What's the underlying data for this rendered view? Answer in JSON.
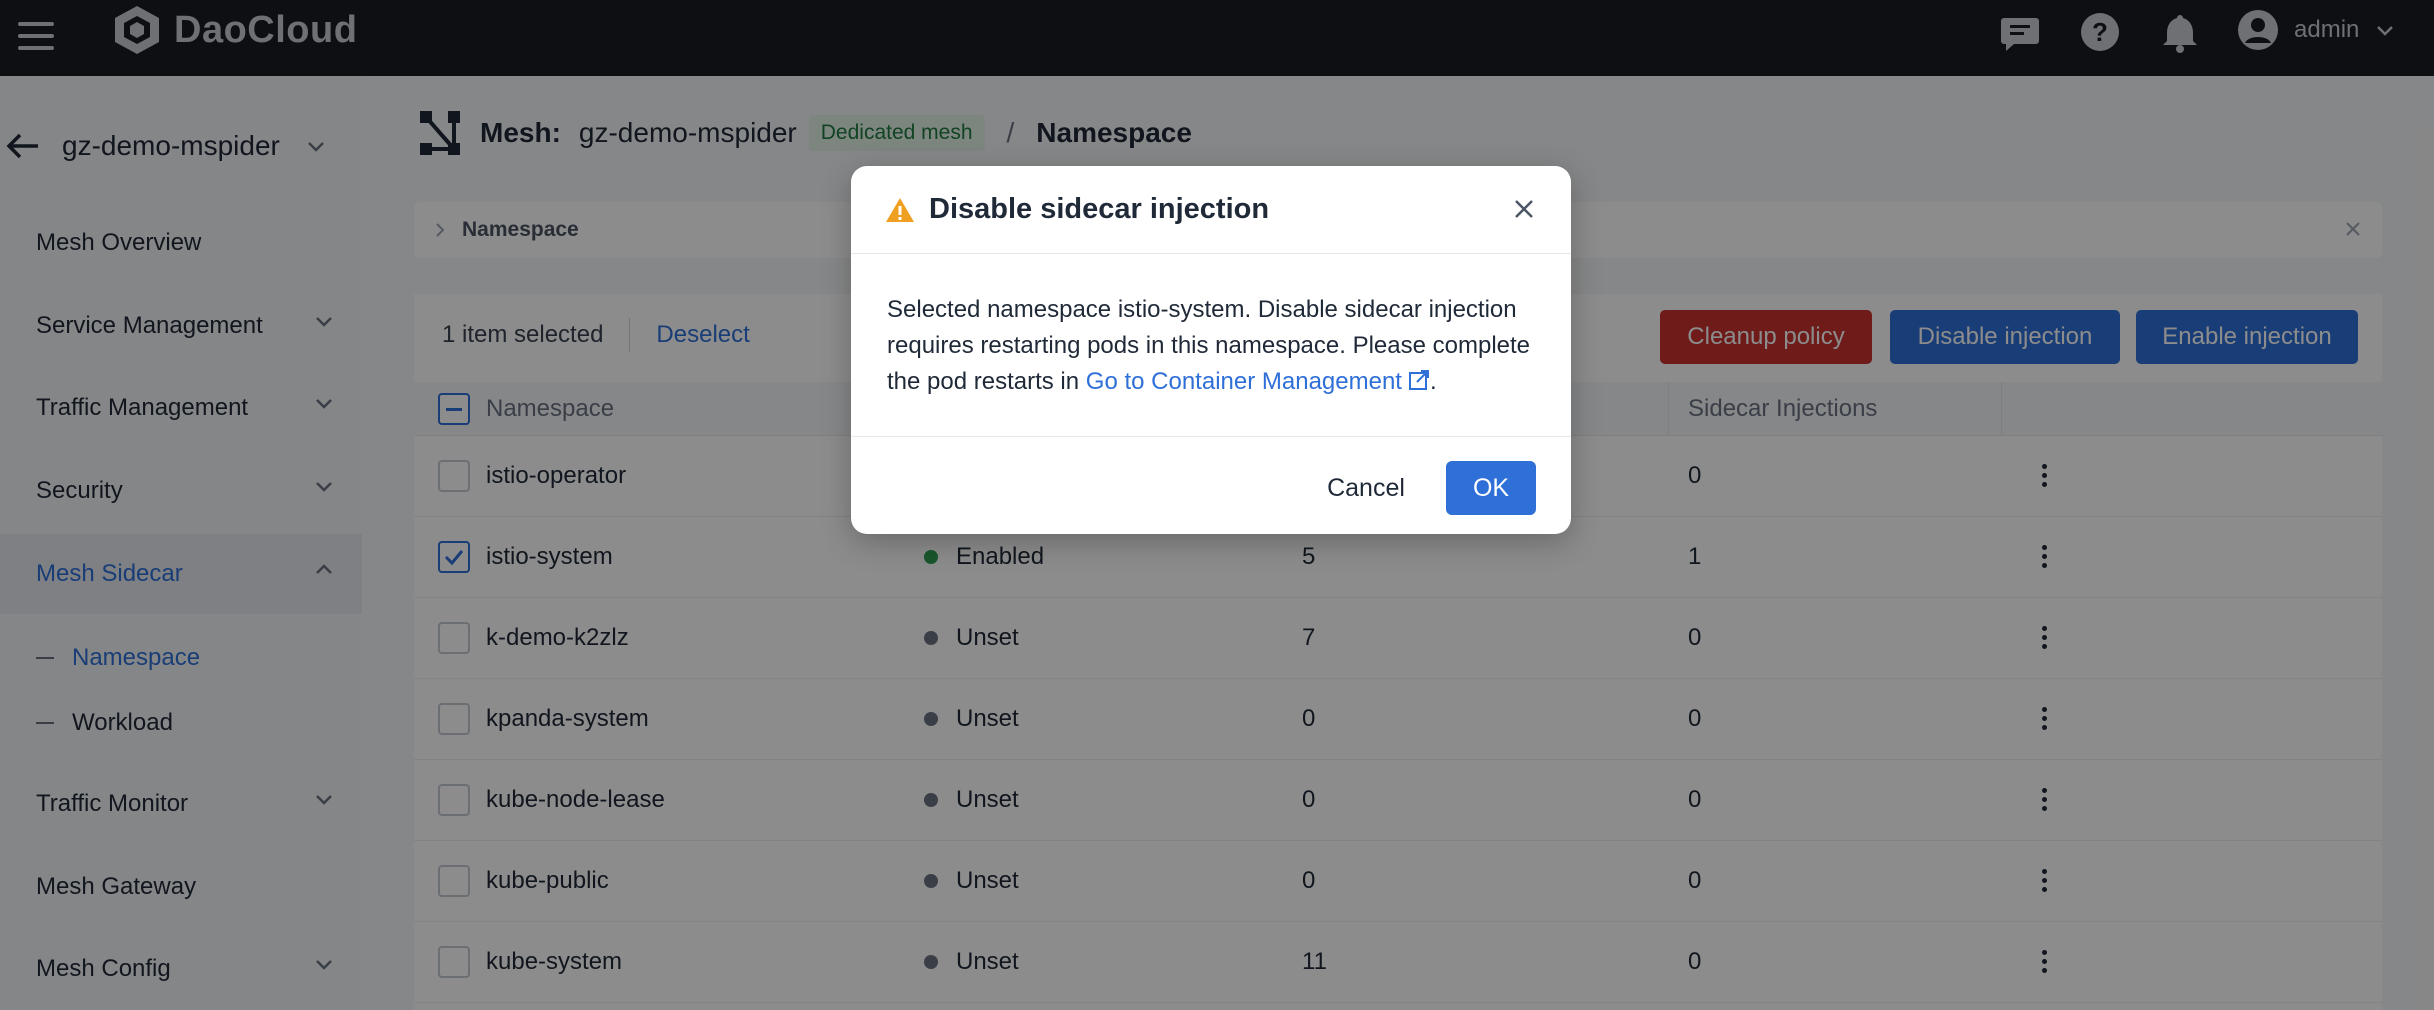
{
  "topbar": {
    "brand": "DaoCloud",
    "user_name": "admin"
  },
  "sidebar": {
    "mesh_name": "gz-demo-mspider",
    "items": [
      {
        "label": "Mesh Overview"
      },
      {
        "label": "Service Management"
      },
      {
        "label": "Traffic Management"
      },
      {
        "label": "Security"
      },
      {
        "label": "Mesh Sidecar"
      },
      {
        "label": "Traffic Monitor"
      },
      {
        "label": "Mesh Gateway"
      },
      {
        "label": "Mesh Config"
      }
    ],
    "sub_items": [
      {
        "label": "Namespace"
      },
      {
        "label": "Workload"
      }
    ]
  },
  "header": {
    "mesh_label": "Mesh:",
    "mesh_name": "gz-demo-mspider",
    "mesh_tag": "Dedicated mesh",
    "separator": "/",
    "page": "Namespace"
  },
  "filter": {
    "label": "Namespace"
  },
  "toolbar": {
    "selected_text": "1 item selected",
    "deselect": "Deselect",
    "cleanup": "Cleanup policy",
    "disable": "Disable injection",
    "enable": "Enable injection"
  },
  "table": {
    "columns": {
      "namespace": "Namespace",
      "sidecar_injections": "Sidecar Injections"
    },
    "rows": [
      {
        "namespace": "istio-operator",
        "status": "",
        "pods": "",
        "injections": "0",
        "checked": false,
        "dot": ""
      },
      {
        "namespace": "istio-system",
        "status": "Enabled",
        "pods": "5",
        "injections": "1",
        "checked": true,
        "dot": "#2e9e4f"
      },
      {
        "namespace": "k-demo-k2zlz",
        "status": "Unset",
        "pods": "7",
        "injections": "0",
        "checked": false,
        "dot": "#6b7280"
      },
      {
        "namespace": "kpanda-system",
        "status": "Unset",
        "pods": "0",
        "injections": "0",
        "checked": false,
        "dot": "#6b7280"
      },
      {
        "namespace": "kube-node-lease",
        "status": "Unset",
        "pods": "0",
        "injections": "0",
        "checked": false,
        "dot": "#6b7280"
      },
      {
        "namespace": "kube-public",
        "status": "Unset",
        "pods": "0",
        "injections": "0",
        "checked": false,
        "dot": "#6b7280"
      },
      {
        "namespace": "kube-system",
        "status": "Unset",
        "pods": "11",
        "injections": "0",
        "checked": false,
        "dot": "#6b7280"
      }
    ]
  },
  "dialog": {
    "title": "Disable sidecar injection",
    "body_text": "Selected namespace istio-system. Disable sidecar injection requires restarting pods in this namespace. Please complete the pod restarts in ",
    "link_text": "Go to Container Management",
    "body_end": ".",
    "cancel": "Cancel",
    "ok": "OK"
  },
  "colors": {
    "accent": "#2f6fd8",
    "danger": "#c9322f",
    "warning": "#f0a020",
    "topbar": "#181c22"
  }
}
